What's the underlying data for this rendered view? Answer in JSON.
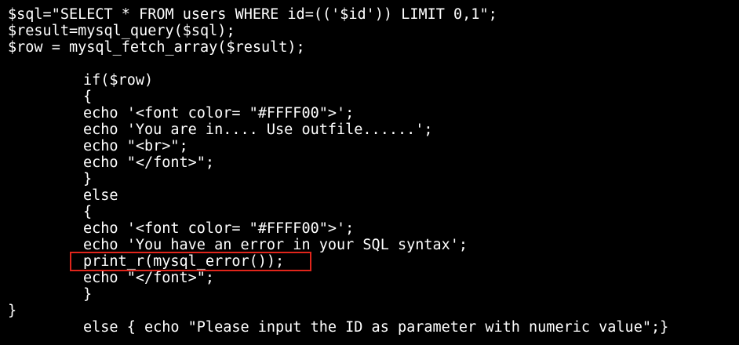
{
  "window": {
    "background": "#000000",
    "text_color": "#ffffff"
  },
  "highlight": {
    "color": "#e1251b"
  },
  "code": {
    "lines": [
      "$sql=\"SELECT * FROM users WHERE id=(('$id')) LIMIT 0,1\";",
      "$result=mysql_query($sql);",
      "$row = mysql_fetch_array($result);",
      "",
      "if($row)",
      "{",
      "echo '<font color= \"#FFFF00\">';",
      "echo 'You are in.... Use outfile......';",
      "echo \"<br>\";",
      "echo \"</font>\";",
      "}",
      "else",
      "{",
      "echo '<font color= \"#FFFF00\">';",
      "echo 'You have an error in your SQL syntax';",
      "print_r(mysql_error());",
      "echo \"</font>\";",
      "}",
      "}",
      "else { echo \"Please input the ID as parameter with numeric value\";}"
    ]
  }
}
